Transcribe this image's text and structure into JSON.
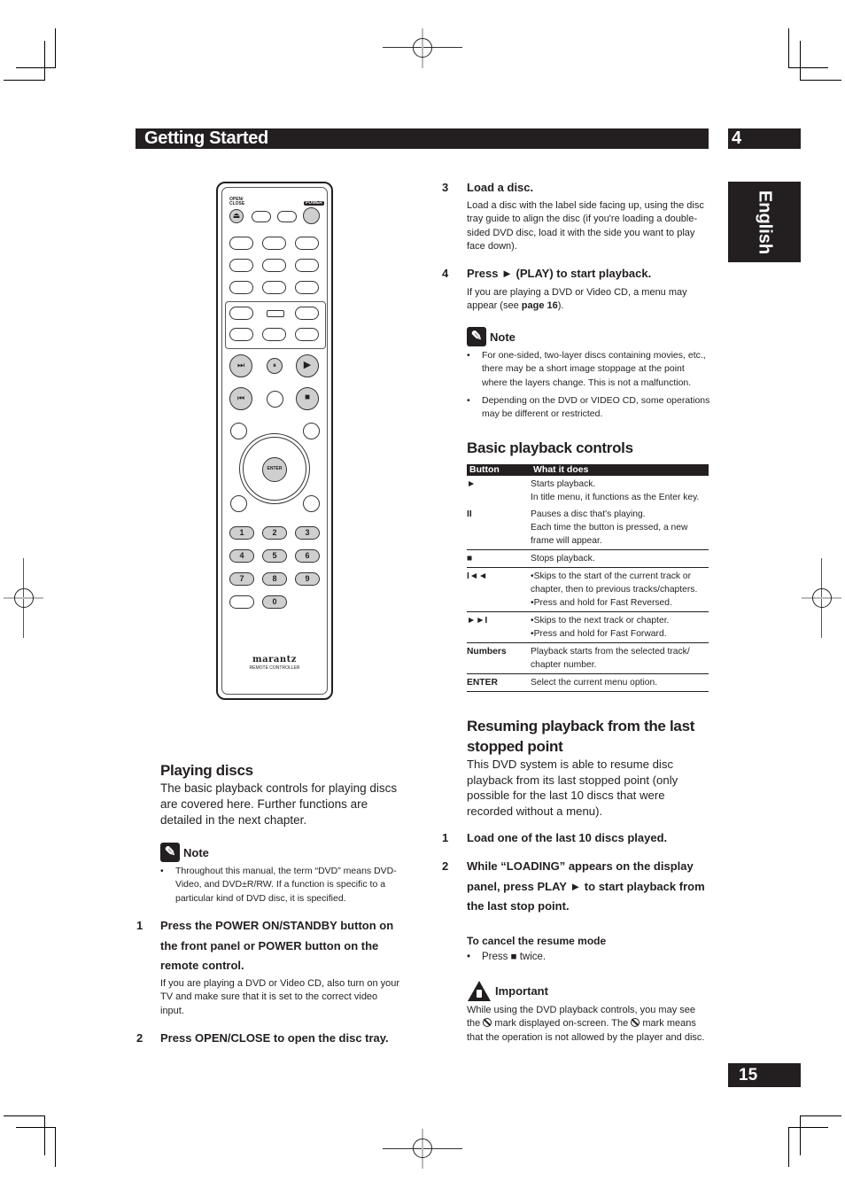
{
  "header": {
    "section_title": "Getting Started",
    "chapter_number": "4"
  },
  "side_tab": {
    "language": "English"
  },
  "page_number": "15",
  "remote": {
    "open_close_label": "OPEN/\nCLOSE",
    "power_label": "POWER",
    "enter_label": "ENTER",
    "number_keys": [
      "1",
      "2",
      "3",
      "4",
      "5",
      "6",
      "7",
      "8",
      "9",
      "0"
    ],
    "brand": "marantz",
    "brand_sub": "REMOTE CONTROLLER",
    "icons": {
      "eject": "⏏",
      "next": "⏭",
      "pause": "⏸",
      "play": "▶",
      "prev": "⏮",
      "stop": "■"
    }
  },
  "playing_discs": {
    "heading": "Playing discs",
    "intro": "The basic playback controls for playing discs are covered here. Further functions are detailed in the next chapter.",
    "note_label": "Note",
    "note_bullets": [
      "Throughout this manual, the term “DVD” means DVD-Video, and DVD±R/RW. If a function is specific to a particular kind of DVD disc, it is specified."
    ],
    "steps": [
      {
        "num": "1",
        "title": "Press the POWER ON/STANDBY button on the front panel or POWER button on the remote control.",
        "body": "If you are playing a DVD or Video CD, also turn on your TV and make sure that it is set to the correct video input."
      },
      {
        "num": "2",
        "title": "Press OPEN/CLOSE to open the disc tray.",
        "body": ""
      },
      {
        "num": "3",
        "title": "Load a disc.",
        "body": "Load a disc with the label side facing up, using the disc tray guide to align the disc (if you're loading a double-sided DVD disc, load it with the side you want to play face down)."
      },
      {
        "num": "4",
        "title": "Press ► (PLAY) to start playback.",
        "body_pre": "If you are playing a DVD or Video CD, a menu may appear (see ",
        "body_bold": "page 16",
        "body_post": ")."
      }
    ],
    "note2_label": "Note",
    "note2_bullets": [
      "For one-sided, two-layer discs containing movies, etc., there may be a short image stoppage at the point where the layers change. This is not a malfunction.",
      "Depending on the DVD or VIDEO CD, some operations may be different or restricted."
    ]
  },
  "basic_controls": {
    "heading": "Basic playback controls",
    "columns": [
      "Button",
      "What it does"
    ],
    "rows": [
      {
        "button": "►",
        "desc": [
          "Starts playback.",
          "In title menu, it functions as the Enter key."
        ]
      },
      {
        "button": "II",
        "desc": [
          "Pauses a disc that's playing.",
          "Each time the button is pressed, a new frame will appear."
        ]
      },
      {
        "button": "■",
        "desc": [
          "Stops playback."
        ]
      },
      {
        "button": "I◄◄",
        "desc": [
          "•Skips to the start of the current track or chapter, then to previous tracks/chapters.",
          "•Press and hold for Fast Reversed."
        ]
      },
      {
        "button": "►►I",
        "desc": [
          "•Skips to the next track or chapter.",
          "•Press and hold for Fast Forward."
        ]
      },
      {
        "button": "Numbers",
        "desc": [
          "Playback starts from the selected track/ chapter number."
        ]
      },
      {
        "button": "ENTER",
        "desc": [
          "Select the current menu option."
        ]
      }
    ]
  },
  "resume": {
    "heading": "Resuming playback from the last stopped point",
    "intro": "This DVD system is able to resume disc playback from its last stopped point (only possible for the last 10 discs that were recorded without a menu).",
    "steps": [
      {
        "num": "1",
        "title": "Load one of the last 10 discs played."
      },
      {
        "num": "2",
        "title": "While “LOADING” appears on the display panel, press PLAY ► to start playback from the last stop point."
      }
    ],
    "cancel_heading": "To cancel the resume mode",
    "cancel_bullet": "Press ■ twice.",
    "important_label": "Important",
    "important_text_1": "While using the DVD playback controls, you may see the ",
    "important_text_2": " mark displayed on-screen. The ",
    "important_text_3": " mark means that the operation is not allowed by the player and disc."
  }
}
